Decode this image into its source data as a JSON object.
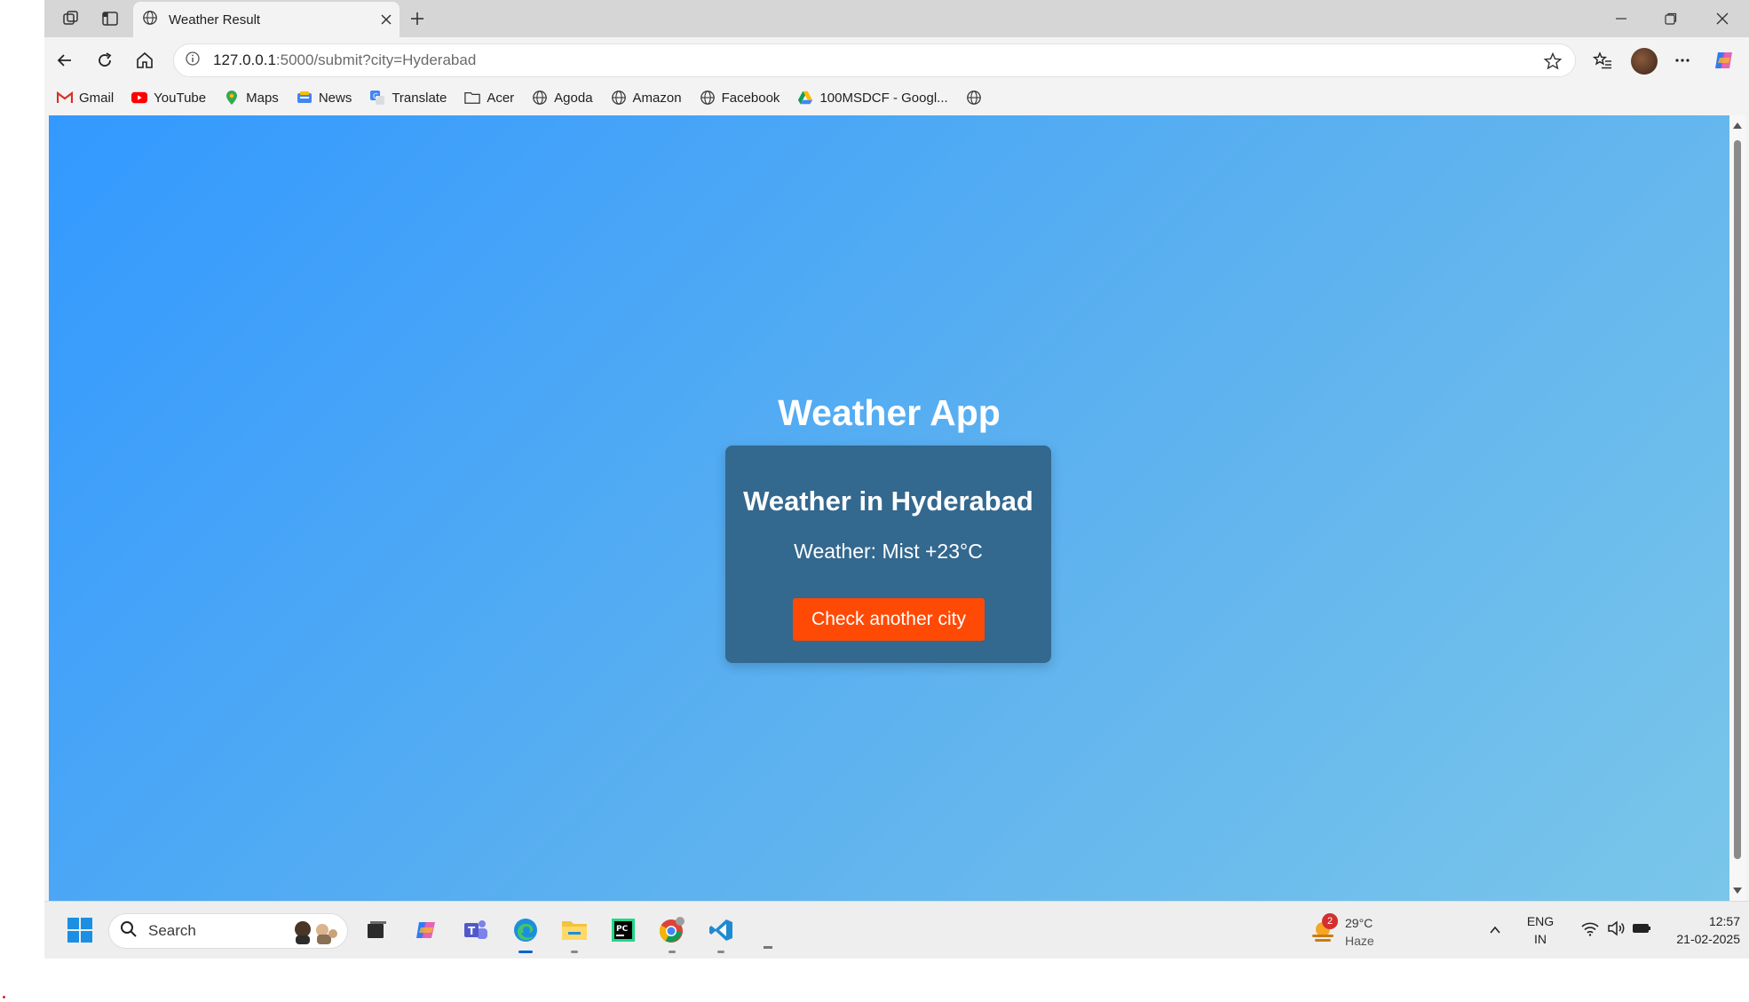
{
  "tab": {
    "title": "Weather Result"
  },
  "address_bar": {
    "host": "127.0.0.1",
    "path": ":5000/submit?city=Hyderabad"
  },
  "bookmarks": [
    {
      "label": "Gmail",
      "icon": "gmail-icon"
    },
    {
      "label": "YouTube",
      "icon": "youtube-icon"
    },
    {
      "label": "Maps",
      "icon": "maps-icon"
    },
    {
      "label": "News",
      "icon": "news-icon"
    },
    {
      "label": "Translate",
      "icon": "translate-icon"
    },
    {
      "label": "Acer",
      "icon": "folder-icon"
    },
    {
      "label": "Agoda",
      "icon": "globe-icon"
    },
    {
      "label": "Amazon",
      "icon": "globe-icon"
    },
    {
      "label": "Facebook",
      "icon": "globe-icon"
    },
    {
      "label": "100MSDCF - Googl...",
      "icon": "google-drive-icon"
    }
  ],
  "page": {
    "app_title": "Weather App",
    "card_title": "Weather in Hyderabad",
    "weather_text": "Weather: Mist +23°C",
    "button_label": "Check another city"
  },
  "taskbar": {
    "search_placeholder": "Search",
    "weather_temp": "29°C",
    "weather_desc": "Haze",
    "weather_badge": "2",
    "lang_line1": "ENG",
    "lang_line2": "IN",
    "time": "12:57",
    "date": "21-02-2025"
  },
  "colors": {
    "page_gradient_start": "#3399ff",
    "page_gradient_end": "#7ac6ea",
    "card_bg": "#33688f",
    "button_bg": "#ff4a05"
  }
}
